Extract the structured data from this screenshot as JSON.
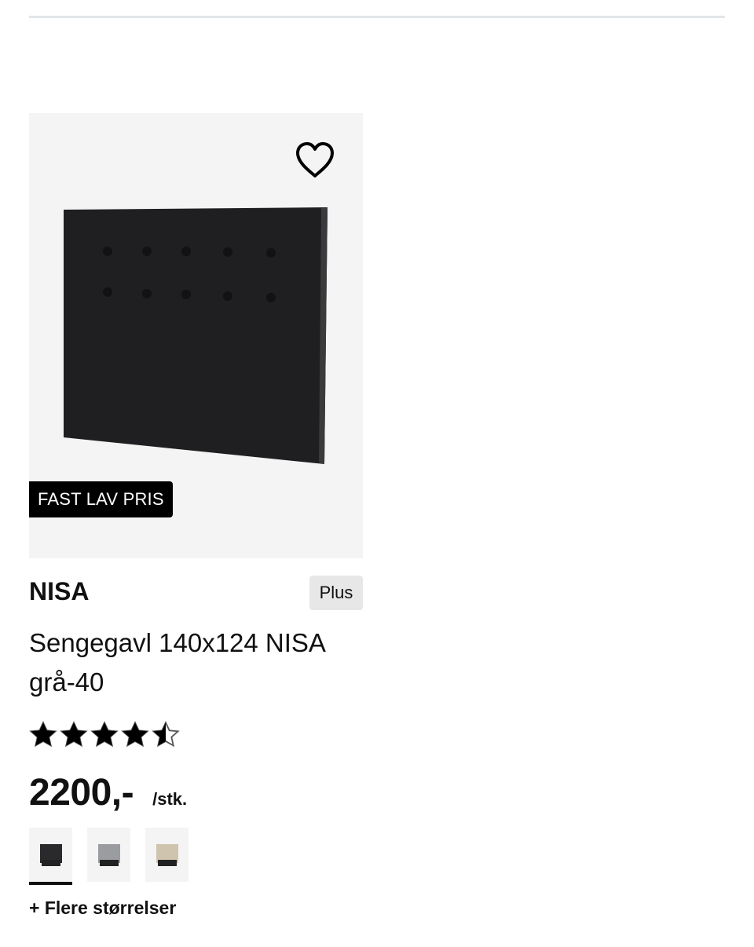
{
  "product": {
    "badge": "FAST LAV PRIS",
    "brand": "NISA",
    "membership_badge": "Plus",
    "description": "Sengegavl 140x124 NISA grå-40",
    "rating": 4.5,
    "rating_max": 5,
    "price": "2200,-",
    "price_unit": "/stk.",
    "favorite_icon": "heart-outline-icon",
    "swatches": [
      {
        "color": "#2a2a2c",
        "selected": true
      },
      {
        "color": "#9a9ca0",
        "selected": false
      },
      {
        "color": "#cfc5ae",
        "selected": false
      }
    ],
    "more_sizes": "+ Flere størrelser"
  }
}
